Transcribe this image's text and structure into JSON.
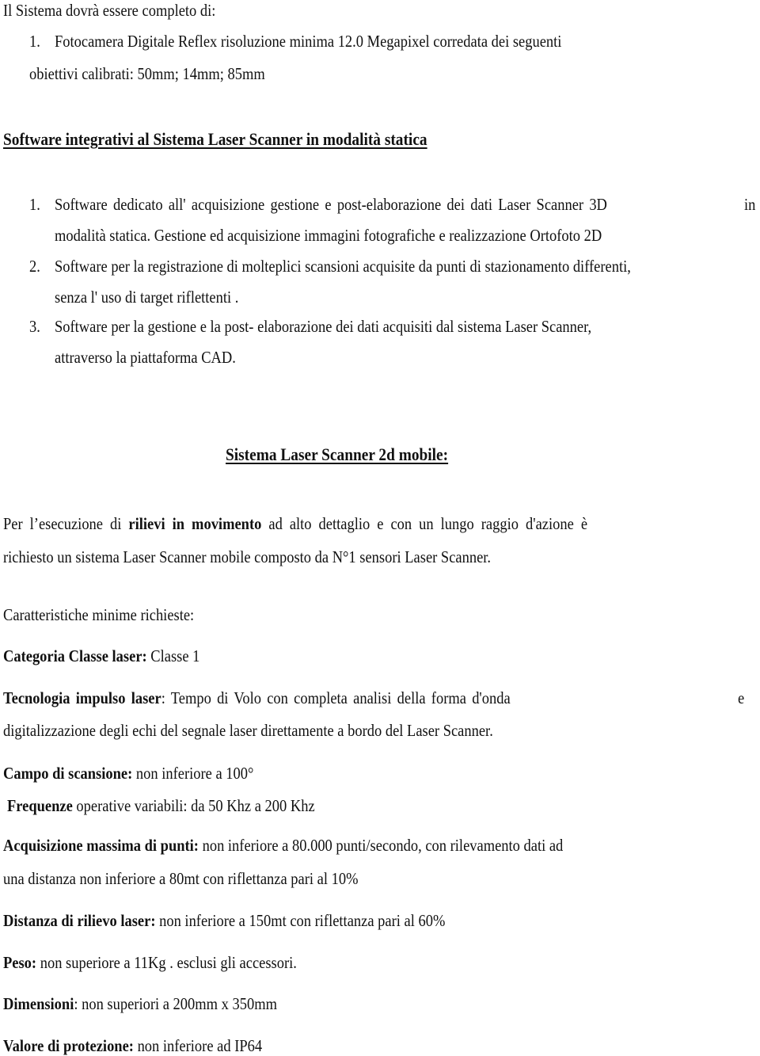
{
  "intro": "Il Sistema dovrà essere  completo di:",
  "camera_item": {
    "num": "1.",
    "line1": "Fotocamera Digitale Reflex risoluzione minima 12.0 Megapixel corredata dei seguenti",
    "line2": "obiettivi calibrati:  50mm;  14mm; 85mm"
  },
  "software_heading": "Software integrativi al Sistema Laser Scanner in modalità statica",
  "software_items": [
    {
      "num": "1.",
      "line1": "Software  dedicato all' acquisizione gestione e post-elaborazione dei dati Laser Scanner 3D",
      "line1_end": "in",
      "line2": "modalità statica. Gestione ed acquisizione immagini fotografiche e realizzazione Ortofoto 2D"
    },
    {
      "num": "2.",
      "line1": "Software  per la registrazione di molteplici scansioni  acquisite da punti di stazionamento differenti,",
      "line2": "senza l' uso di target riflettenti ."
    },
    {
      "num": "3.",
      "line1": "Software per la gestione e la post- elaborazione dei dati acquisiti dal sistema Laser Scanner,",
      "line2": "attraverso la  piattaforma CAD."
    }
  ],
  "mobile_heading": "Sistema Laser Scanner 2d mobile:",
  "mobile_intro": {
    "pre": "Per l’esecuzione di ",
    "bold": "rilievi in movimento",
    "post": " ad alto dettaglio e con un lungo raggio d'azione è",
    "line2": "richiesto un sistema Laser Scanner mobile composto da N°1 sensori Laser Scanner."
  },
  "requirements_label": "Caratteristiche minime richieste:",
  "specs": {
    "categoria": {
      "label": "Categoria Classe laser:",
      "value": " Classe 1"
    },
    "tecnologia": {
      "label": "Tecnologia  impulso  laser",
      "value": ":  Tempo  di  Volo  con    completa  analisi  della  forma  d'onda",
      "end": "e",
      "line2": "digitalizzazione degli echi del segnale laser direttamente a bordo del Laser Scanner."
    },
    "campo": {
      "label": "Campo di scansione:",
      "value": " non inferiore a  100°"
    },
    "frequenze": {
      "label": "Frequenze",
      "value": " operative variabili: da 50 Khz a 200 Khz"
    },
    "acquisizione": {
      "label": "Acquisizione massima di punti:",
      "value": " non inferiore a 80.000 punti/secondo,  con rilevamento dati ad",
      "line2": "una distanza non inferiore a 80mt con riflettanza pari al 10%"
    },
    "distanza": {
      "label": "Distanza di rilievo laser:",
      "value": " non inferiore a 150mt con riflettanza pari al 60%"
    },
    "peso": {
      "label": "Peso:",
      "value": " non superiore a 11Kg . esclusi gli accessori."
    },
    "dimensioni": {
      "label": "Dimensioni",
      "value": ": non superiori a 200mm x 350mm"
    },
    "protezione": {
      "label": "Valore di protezione:",
      "value": " non inferiore ad IP64"
    }
  }
}
